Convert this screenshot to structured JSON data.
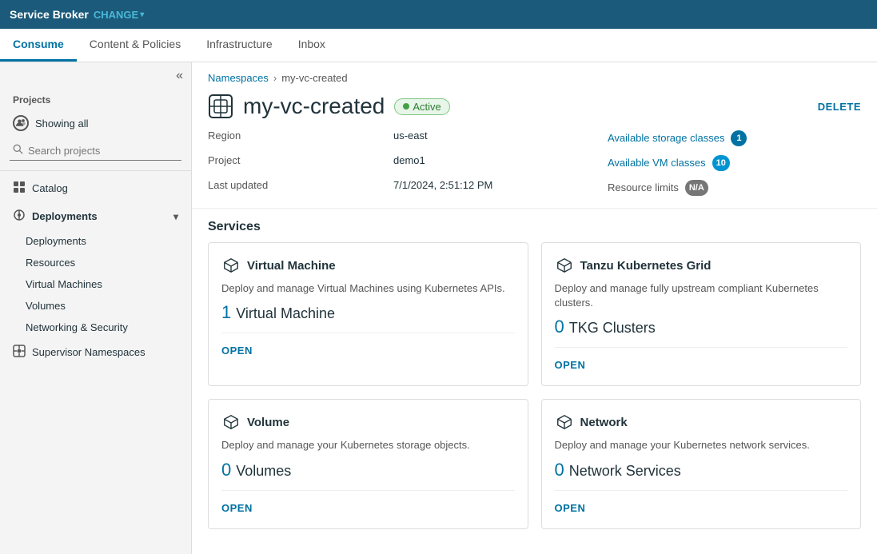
{
  "topNav": {
    "brand": "Service Broker",
    "change": "CHANGE",
    "chevron": "▾"
  },
  "tabs": [
    {
      "label": "Consume",
      "active": true
    },
    {
      "label": "Content & Policies",
      "active": false
    },
    {
      "label": "Infrastructure",
      "active": false
    },
    {
      "label": "Inbox",
      "active": false
    }
  ],
  "sidebar": {
    "collapseIcon": "«",
    "projectsLabel": "Projects",
    "showingAll": "Showing all",
    "searchPlaceholder": "Search projects",
    "navItems": [
      {
        "label": "Catalog",
        "icon": "catalog",
        "type": "nav"
      },
      {
        "label": "Deployments",
        "icon": "deployments",
        "type": "expandable",
        "expanded": true
      },
      {
        "label": "Deployments",
        "type": "sub"
      },
      {
        "label": "Resources",
        "type": "sub"
      },
      {
        "label": "Virtual Machines",
        "type": "sub"
      },
      {
        "label": "Volumes",
        "type": "sub"
      },
      {
        "label": "Networking & Security",
        "type": "sub"
      },
      {
        "label": "Supervisor Namespaces",
        "icon": "namespaces",
        "type": "nav"
      }
    ]
  },
  "breadcrumb": {
    "parent": "Namespaces",
    "separator": "›",
    "current": "my-vc-created"
  },
  "pageHeader": {
    "title": "my-vc-created",
    "status": "Active",
    "deleteLabel": "DELETE"
  },
  "info": {
    "regionLabel": "Region",
    "regionValue": "us-east",
    "projectLabel": "Project",
    "projectValue": "demo1",
    "lastUpdatedLabel": "Last updated",
    "lastUpdatedValue": "7/1/2024, 2:51:12 PM",
    "storageClassesLink": "Available storage classes",
    "storageClassesBadge": "1",
    "vmClassesLink": "Available VM classes",
    "vmClassesBadge": "10",
    "resourceLimitsLabel": "Resource limits",
    "resourceLimitsBadge": "N/A"
  },
  "services": {
    "title": "Services",
    "cards": [
      {
        "id": "vm",
        "title": "Virtual Machine",
        "description": "Deploy and manage Virtual Machines using Kubernetes APIs.",
        "countNum": "1",
        "countLabel": "Virtual Machine",
        "openLabel": "OPEN"
      },
      {
        "id": "tkg",
        "title": "Tanzu Kubernetes Grid",
        "description": "Deploy and manage fully upstream compliant Kubernetes clusters.",
        "countNum": "0",
        "countLabel": "TKG Clusters",
        "openLabel": "OPEN"
      },
      {
        "id": "volume",
        "title": "Volume",
        "description": "Deploy and manage your Kubernetes storage objects.",
        "countNum": "0",
        "countLabel": "Volumes",
        "openLabel": "OPEN"
      },
      {
        "id": "network",
        "title": "Network",
        "description": "Deploy and manage your Kubernetes network services.",
        "countNum": "0",
        "countLabel": "Network Services",
        "openLabel": "OPEN"
      }
    ]
  }
}
